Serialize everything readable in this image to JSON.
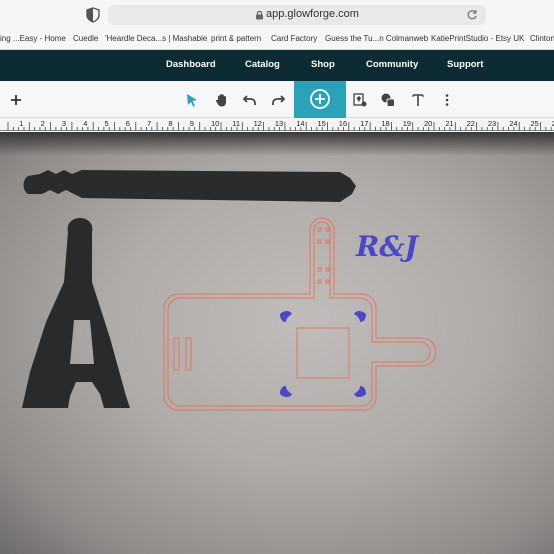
{
  "browser": {
    "url": "app.glowforge.com",
    "bookmarks": [
      "ing ...Easy - Home",
      "Cuedle",
      "'Heardle Deca...s | Mashable",
      "print & pattern",
      "Card Factory",
      "Guess the Tu...n Colmanweb",
      "KatiePrintStudio - Etsy UK",
      "Clinton"
    ]
  },
  "nav": {
    "items": [
      "Dashboard",
      "Catalog",
      "Shop",
      "Community",
      "Support"
    ]
  },
  "toolbar": {
    "icons": [
      "plus-icon",
      "pointer-icon",
      "hand-icon",
      "undo-icon",
      "redo-icon",
      "add-icon",
      "trace-icon",
      "shapes-icon",
      "text-icon",
      "more-icon"
    ],
    "accent": "#2aa3b8"
  },
  "ruler": {
    "numbers": [
      "1",
      "2",
      "3",
      "4",
      "5",
      "6",
      "7",
      "8",
      "9",
      "10",
      "11",
      "12",
      "13",
      "14",
      "15",
      "16",
      "17",
      "18",
      "19",
      "20",
      "21",
      "22",
      "23",
      "24",
      "25",
      "26",
      "27"
    ]
  },
  "design": {
    "monogram": "R&J",
    "cut_color": "#e2775f",
    "engrave_color": "#4a47c9"
  }
}
